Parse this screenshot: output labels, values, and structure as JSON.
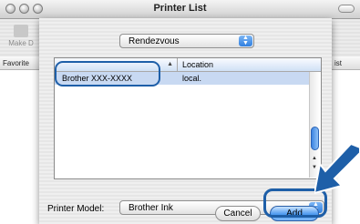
{
  "window": {
    "title": "Printer List"
  },
  "background": {
    "make_default_label": "Make D",
    "favorites_label": "Favorite",
    "list_column_partial": "ist"
  },
  "sheet": {
    "connection_type": "Rendezvous",
    "list": {
      "columns": {
        "name": "",
        "location": "Location"
      },
      "rows": [
        {
          "name": "Brother  XXX-XXXX",
          "location": "local."
        }
      ]
    },
    "printer_model_label": "Printer Model:",
    "printer_model_value": "Brother Ink",
    "cancel_label": "Cancel",
    "add_label": "Add"
  },
  "colors": {
    "selection": "#c8d9f2",
    "accent": "#1e5fa8"
  },
  "icons": {
    "sort": "sort-ascending-icon",
    "popup": "up-down-arrows-icon",
    "pointer": "callout-arrow-icon"
  }
}
